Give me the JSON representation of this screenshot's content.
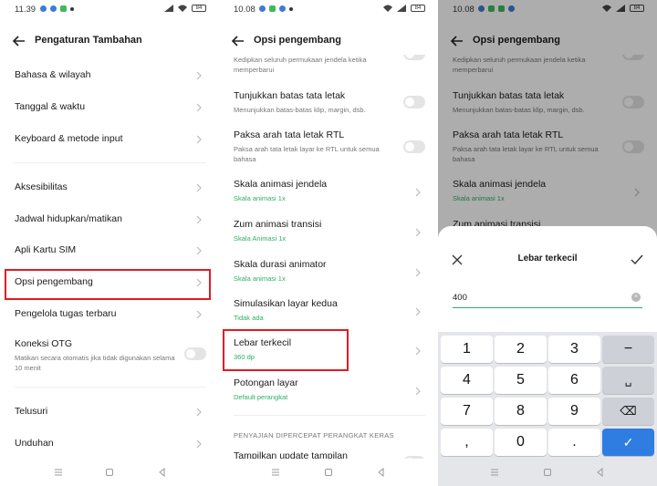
{
  "panel1": {
    "status_time": "11.39",
    "title": "Pengaturan Tambahan",
    "items": [
      {
        "label": "Bahasa & wilayah"
      },
      {
        "label": "Tanggal & waktu"
      },
      {
        "label": "Keyboard & metode input"
      },
      {
        "label": "Aksesibilitas"
      },
      {
        "label": "Jadwal hidupkan/matikan"
      },
      {
        "label": "Apli Kartu SIM"
      },
      {
        "label": "Opsi pengembang"
      },
      {
        "label": "Pengelola tugas terbaru"
      },
      {
        "label": "Koneksi OTG",
        "sub": "Matikan secara otomatis jika tidak digunakan selama 10 menit"
      },
      {
        "label": "Telusuri"
      },
      {
        "label": "Unduhan"
      }
    ]
  },
  "panel2": {
    "status_time": "10.08",
    "title": "Opsi pengembang",
    "top_cut": "Kedipkan seluruh permukaan jendela ketika memperbarui",
    "items": [
      {
        "label": "Tunjukkan batas tata letak",
        "sub": "Menunjukkan batas-batas klip, margin, dsb."
      },
      {
        "label": "Paksa arah tata letak RTL",
        "sub": "Paksa arah tata letak layar ke RTL untuk semua bahasa"
      },
      {
        "label": "Skala animasi jendela",
        "val": "Skala animasi 1x"
      },
      {
        "label": "Zum animasi transisi",
        "val": "Skala Animasi 1x"
      },
      {
        "label": "Skala durasi animator",
        "val": "Skala animasi 1x"
      },
      {
        "label": "Simulasikan layar kedua",
        "val": "Tidak ada"
      },
      {
        "label": "Lebar terkecil",
        "val": "360 dp"
      },
      {
        "label": "Potongan layar",
        "val": "Default perangkat"
      }
    ],
    "section": "PENYAJIAN DIPERCEPAT PERANGKAT KERAS",
    "bottom_cut": "Tampilkan update tampilan"
  },
  "panel3": {
    "status_time": "10.08",
    "title": "Opsi pengembang",
    "bg_top_cut": "Kedipkan seluruh permukaan jendela ketika memperbarui",
    "bg_items": [
      {
        "label": "Tunjukkan batas tata letak",
        "sub": "Menunjukkan batas-batas klip, margin, dsb."
      },
      {
        "label": "Paksa arah tata letak RTL",
        "sub": "Paksa arah tata letak layar ke RTL untuk semua bahasa"
      },
      {
        "label": "Skala animasi jendela",
        "val": "Skala animasi 1x"
      },
      {
        "label": "Zum animasi transisi"
      }
    ],
    "dialog": {
      "title": "Lebar terkecil",
      "value": "400"
    },
    "keys": [
      "1",
      "2",
      "3",
      "−",
      "4",
      "5",
      "6",
      "␣",
      "7",
      "8",
      "9",
      "⌫",
      ",",
      "0",
      ".",
      "✓"
    ]
  },
  "icons": {
    "back": "arrow-left-icon",
    "chevron": "chevron-right-icon",
    "close": "close-icon",
    "check": "check-icon",
    "clear": "clear-input-icon"
  },
  "colors": {
    "accent": "#2fae66",
    "highlight": "#e01b24",
    "key_blue": "#2f7de1"
  }
}
